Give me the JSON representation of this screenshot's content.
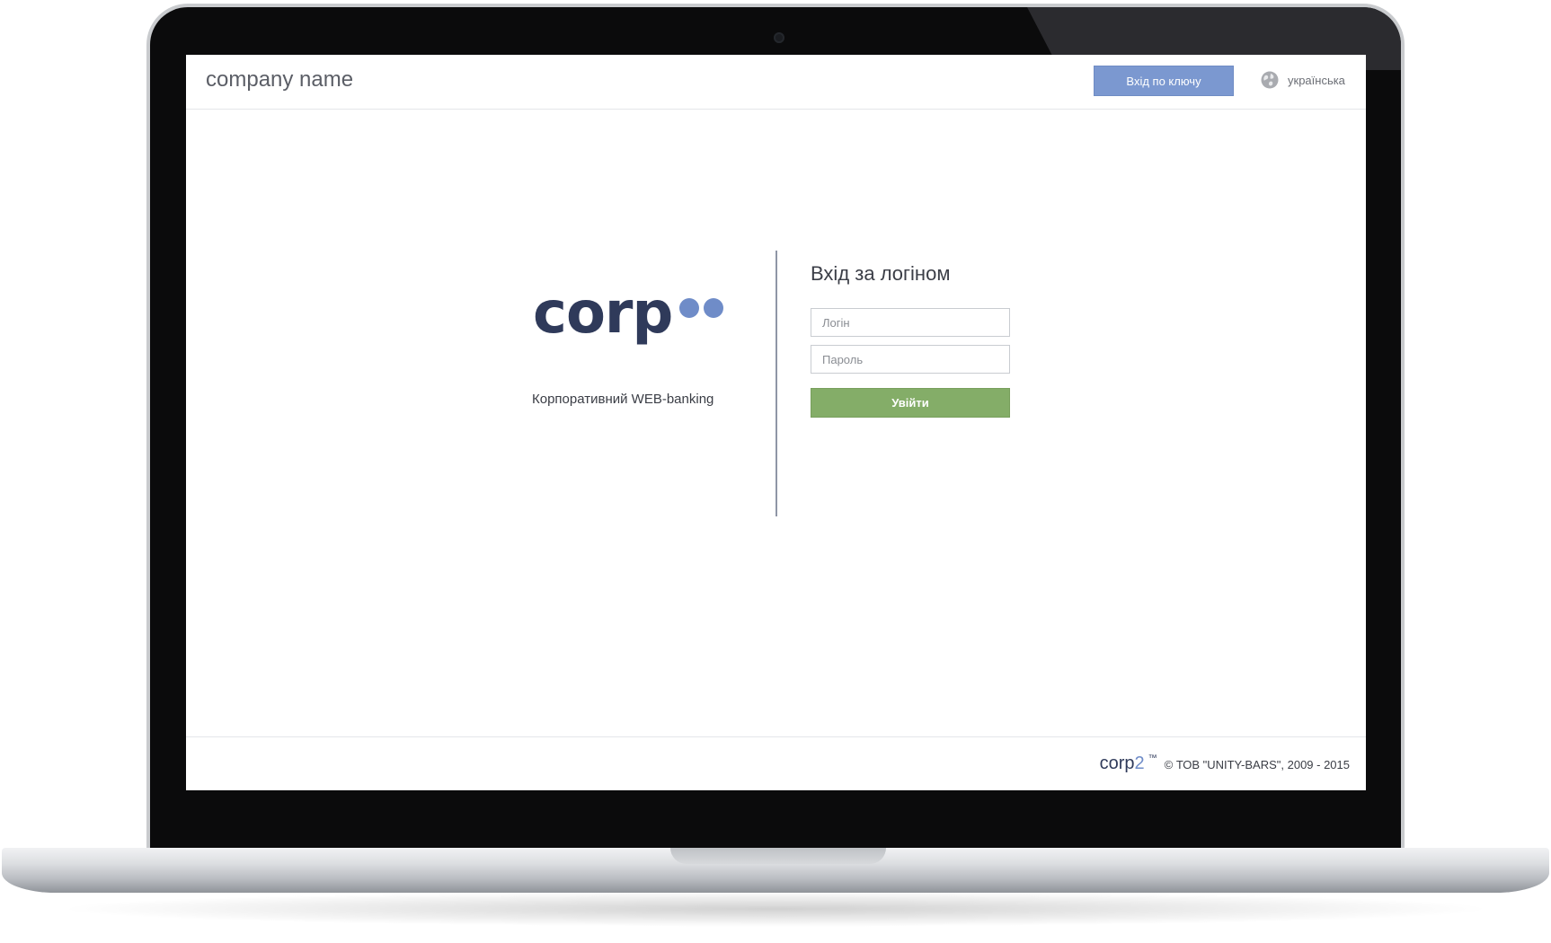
{
  "header": {
    "company_name": "company name",
    "key_login_label": "Вхід по ключу",
    "language_label": "українська",
    "language_icon": "globe-icon"
  },
  "brand": {
    "logo_text": "corp",
    "tagline": "Корпоративний WEB-banking"
  },
  "login_form": {
    "title": "Вхід за логіном",
    "login_placeholder": "Логін",
    "password_placeholder": "Пароль",
    "submit_label": "Увійти"
  },
  "footer": {
    "brand_text": "corp",
    "brand_suffix": "2",
    "trademark": "™",
    "copyright": "© ТОВ \"UNITY-BARS\", 2009 - 2015"
  },
  "colors": {
    "accent_blue": "#7b98d0",
    "submit_green": "#84ad68",
    "brand_navy": "#2f3a5a",
    "brand_dot": "#6f8cc8"
  }
}
